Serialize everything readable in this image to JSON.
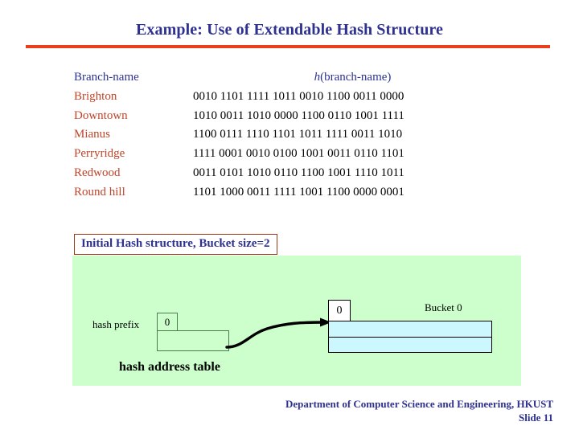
{
  "slide": {
    "title": "Example: Use of Extendable Hash Structure",
    "caption": "Initial Hash structure, Bucket size=2",
    "footer_line1": "Department of Computer Science and Engineering, HKUST",
    "footer_line2": "Slide 11"
  },
  "table": {
    "header_name": "Branch-name",
    "header_hash_prefix": "h",
    "header_hash_rest": "(branch-name)",
    "rows": [
      {
        "name": "Brighton",
        "hash": "0010 1101 1111 1011 0010 1100 0011 0000"
      },
      {
        "name": "Downtown",
        "hash": "1010 0011 1010 0000 1100 0110 1001 1111"
      },
      {
        "name": "Mianus",
        "hash": "1100 0111 1110 1101 1011 1111 0011 1010"
      },
      {
        "name": "Perryridge",
        "hash": "1111 0001 0010 0100 1001 0011 0110 1101"
      },
      {
        "name": "Redwood",
        "hash": "0011 0101 1010 0110 1100 1001 1110 1011"
      },
      {
        "name": "Round hill",
        "hash": "1101 1000 0011 1111 1001 1100 0000 0001"
      }
    ]
  },
  "diagram": {
    "hash_prefix_label": "hash prefix",
    "hash_prefix_value": "0",
    "hash_address_table_label": "hash address table",
    "bucket_depth": "0",
    "bucket_label": "Bucket 0",
    "bucket_slots": [
      "",
      ""
    ]
  },
  "colors": {
    "title": "#2E3192",
    "rule": "#E8401C",
    "branch_name": "#C0452A",
    "panel_background": "#CCFFCC",
    "bucket_fill": "#CCF7FF",
    "caption_border": "#A03818"
  }
}
